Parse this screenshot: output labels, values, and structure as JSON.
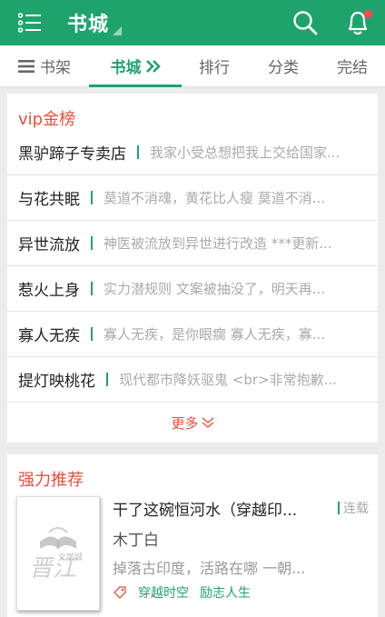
{
  "header": {
    "title": "书城",
    "icons": {
      "menu": "list-menu-icon",
      "search": "search-icon",
      "notify": "bell-user-icon"
    },
    "colors": {
      "brand": "#1fa36c",
      "badge": "#ff4a4a"
    }
  },
  "tabs": [
    {
      "label": "书架",
      "icon": "bookshelf-lines-icon"
    },
    {
      "label": "书城",
      "icon": "double-chevron-right-icon",
      "active": true
    },
    {
      "label": "排行"
    },
    {
      "label": "分类"
    },
    {
      "label": "完结"
    }
  ],
  "vip": {
    "heading": "vip金榜",
    "items": [
      {
        "name": "黑驴蹄子专卖店",
        "desc": "我家小受总想把我上交给国家..."
      },
      {
        "name": "与花共眠",
        "desc": "莫道不消魂，黄花比人瘦  莫道不消..."
      },
      {
        "name": "异世流放",
        "desc": "神医被流放到异世进行改造  ***更新..."
      },
      {
        "name": "惹火上身",
        "desc": "实力潜规则  文案被抽没了，明天再..."
      },
      {
        "name": "寡人无疾",
        "desc": "寡人无疾，是你眼瘸  寡人无疾，寡..."
      },
      {
        "name": "提灯映桃花",
        "desc": "现代都市降妖驱鬼  <br>非常抱歉..."
      }
    ],
    "more_label": "更多",
    "accent": "#e8503a"
  },
  "recommend": {
    "heading": "强力推荐",
    "book": {
      "title": "干了这碗恒河水（穿越印...",
      "status": "连载",
      "author": "木丁白",
      "desc": "掉落古印度，活路在哪  一朝...",
      "cover_icon": "jjwxc-placeholder-cover",
      "cover_logo_text": "文学城",
      "tag_icon": "tag-icon",
      "tags": [
        "穿越时空",
        "励志人生"
      ]
    }
  }
}
